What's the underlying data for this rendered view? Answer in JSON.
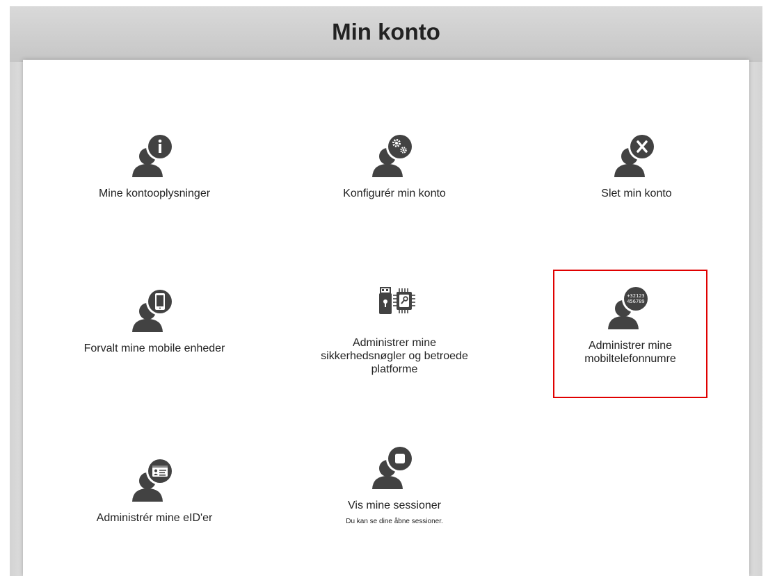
{
  "page": {
    "title": "Min konto"
  },
  "tiles": [
    {
      "label": "Mine kontooplysninger",
      "icon": "user-info-icon"
    },
    {
      "label": "Konfigurér min konto",
      "icon": "user-settings-icon"
    },
    {
      "label": "Slet min konto",
      "icon": "user-delete-icon"
    },
    {
      "label": "Forvalt mine mobile enheder",
      "icon": "user-mobile-device-icon"
    },
    {
      "label": "Administrer mine sikkerhedsnøgler og betroede platforme",
      "icon": "security-key-chip-icon"
    },
    {
      "label": "Administrer mine mobiltelefonnumre",
      "icon": "user-phone-number-icon",
      "badge_line1": "+32123",
      "badge_line2": "456789",
      "selected": true
    },
    {
      "label": "Administrér mine eID'er",
      "icon": "user-id-card-icon"
    },
    {
      "label": "Vis mine sessioner",
      "sub": "Du kan se dine åbne sessioner.",
      "icon": "user-session-icon"
    }
  ],
  "colors": {
    "icon": "#424242",
    "selected_outline": "#e00000"
  }
}
